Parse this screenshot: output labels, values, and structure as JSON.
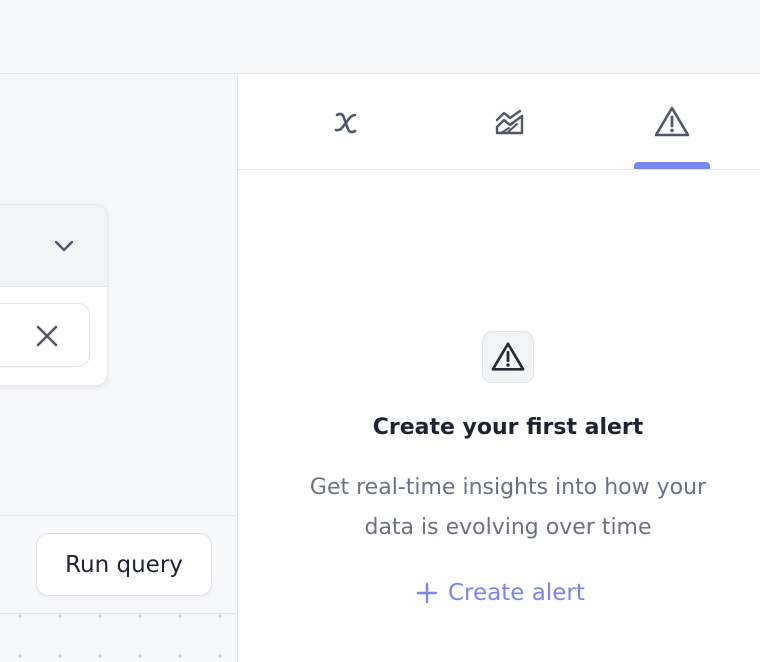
{
  "query_panel": {
    "run_query_label": "Run query"
  },
  "side_panel": {
    "tabs": [
      {
        "name": "variables",
        "icon": "variable-x-icon",
        "active": false
      },
      {
        "name": "charts",
        "icon": "chart-area-icon",
        "active": false
      },
      {
        "name": "alerts",
        "icon": "alert-triangle-icon",
        "active": true
      }
    ],
    "empty_state": {
      "icon": "alert-triangle-icon",
      "title": "Create your first alert",
      "description": "Get real-time insights into how your data is evolving over time",
      "action_label": "Create alert",
      "action_icon": "plus-icon"
    }
  },
  "colors": {
    "accent": "#7a86ee",
    "text_primary": "#1f2330",
    "text_secondary": "#6b7183",
    "icon": "#4f5668"
  }
}
